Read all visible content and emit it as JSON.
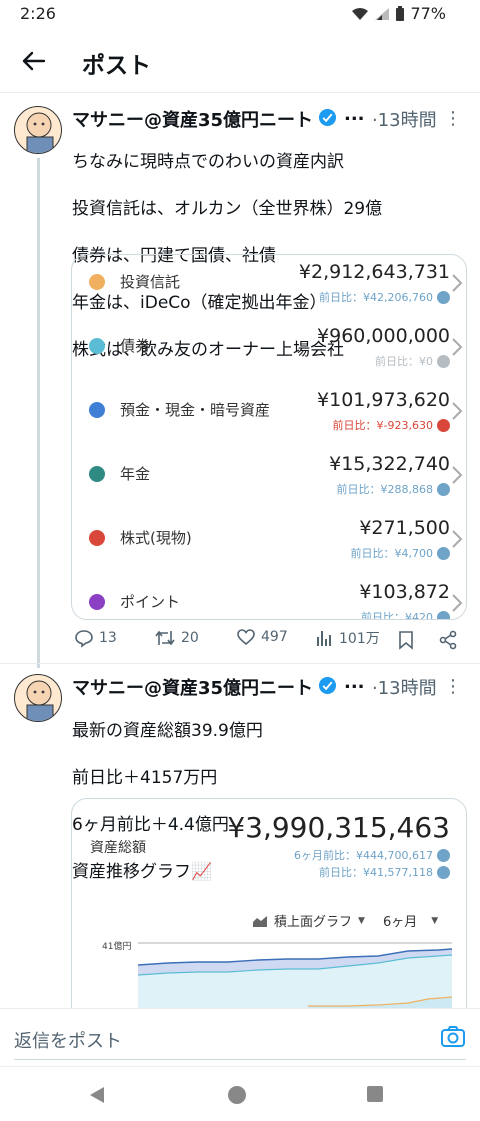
{
  "status_bar": {
    "time": "2:26",
    "battery": "77%"
  },
  "app_bar": {
    "title": "ポスト"
  },
  "post1": {
    "author": "マサニー@資産35億円ニート",
    "ellipsis": "...",
    "time": "·13時間",
    "lines": [
      "ちなみに現時点でのわいの資産内訳",
      "投資信託は、オルカン（全世界株）29億",
      "債券は、円建て国債、社債",
      "年金は、iDeCo（確定拠出年金）",
      "株式は、飲み友のオーナー上場会社"
    ],
    "assets": [
      {
        "label": "投資信託",
        "amount": "¥2,912,643,731",
        "delta": "前日比：¥42,206,760",
        "color": "#f0b060",
        "trend": "up"
      },
      {
        "label": "債券",
        "amount": "¥960,000,000",
        "delta": "前日比：¥0",
        "color": "#5bbcd6",
        "trend": "flat"
      },
      {
        "label": "預金・現金・暗号資産",
        "amount": "¥101,973,620",
        "delta": "前日比：¥-923,630",
        "color": "#3f7fd6",
        "trend": "down"
      },
      {
        "label": "年金",
        "amount": "¥15,322,740",
        "delta": "前日比：¥288,868",
        "color": "#2f8a84",
        "trend": "up"
      },
      {
        "label": "株式(現物)",
        "amount": "¥271,500",
        "delta": "前日比：¥4,700",
        "color": "#d9473a",
        "trend": "up"
      },
      {
        "label": "ポイント",
        "amount": "¥103,872",
        "delta": "前日比：¥420",
        "color": "#8b3fc2",
        "trend": "up"
      }
    ],
    "actions": {
      "replies": "13",
      "reposts": "20",
      "likes": "497",
      "views": "101万"
    }
  },
  "post2": {
    "author": "マサニー@資産35億円ニート",
    "ellipsis": "...",
    "time": "·13時間",
    "lines": [
      "最新の資産総額39.9億円",
      "前日比＋4157万円",
      "6ヶ月前比＋4.4億円",
      "資産推移グラフ📈"
    ],
    "card": {
      "label": "資産総額",
      "amount": "¥3,990,315,463",
      "delta_6m": "6ヶ月前比：¥444,700,617",
      "delta_1d": "前日比：¥41,577,118",
      "chart_type": "積上面グラフ",
      "period": "6ヶ月",
      "axis_label": "41億円"
    }
  },
  "reply": {
    "placeholder": "返信をポスト"
  },
  "colors": {
    "accent": "#1d9bf0",
    "up": "#6fa3c8",
    "flat": "#b5bcc2",
    "down": "#d9473a"
  }
}
